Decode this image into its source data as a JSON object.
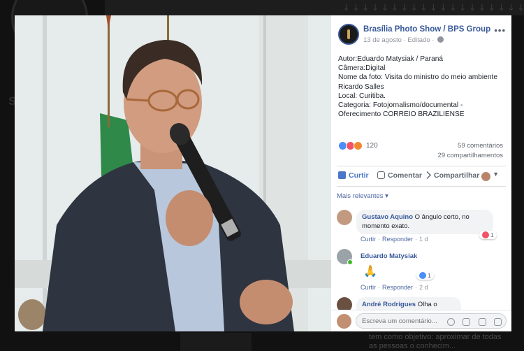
{
  "post": {
    "page_name": "Brasília Photo Show / BPS Group",
    "date": "13 de agosto",
    "separator": "·",
    "edited": "Editado",
    "caption": [
      "Autor:Eduardo Matysiak / Paraná",
      "Câmera:Digital",
      "Nome da foto: Visita do ministro do meio ambiente",
      "Ricardo Salles",
      "Local: Curitiba.",
      "Categoria: Fotojornalismo/documental -",
      "Oferecimento CORREIO BRAZILIENSE"
    ],
    "reaction_count": "120",
    "comments_count": "59 comentários",
    "shares_count": "29 compartilhamentos"
  },
  "actions": {
    "like": "Curtir",
    "comment": "Comentar",
    "share": "Compartilhar"
  },
  "comments_filter": "Mais relevantes ▾",
  "comments": [
    {
      "author": "Gustavo Aquino",
      "text_line1": "O ângulo certo, no",
      "text_line2": "momento exato.",
      "like": "Curtir",
      "reply": "Responder",
      "time": "1 d",
      "reaction_count": "1"
    },
    {
      "author": "Eduardo Matysiak",
      "emoji": "🙏",
      "like": "Curtir",
      "reply": "Responder",
      "time": "2 d",
      "reaction_count": "1"
    },
    {
      "author": "André Rodrigues",
      "text_line1": "Olha o Chifre!"
    }
  ],
  "compose": {
    "placeholder": "Escreva um comentário..."
  },
  "background": {
    "bottom_text": "tem como objetivo: aproximar de todas as pessoas o conhecim..."
  },
  "colors": {
    "link_blue": "#365899",
    "like_blue": "#4b76c9",
    "panel_bg": "#ffffff",
    "backdrop": "#111111"
  }
}
